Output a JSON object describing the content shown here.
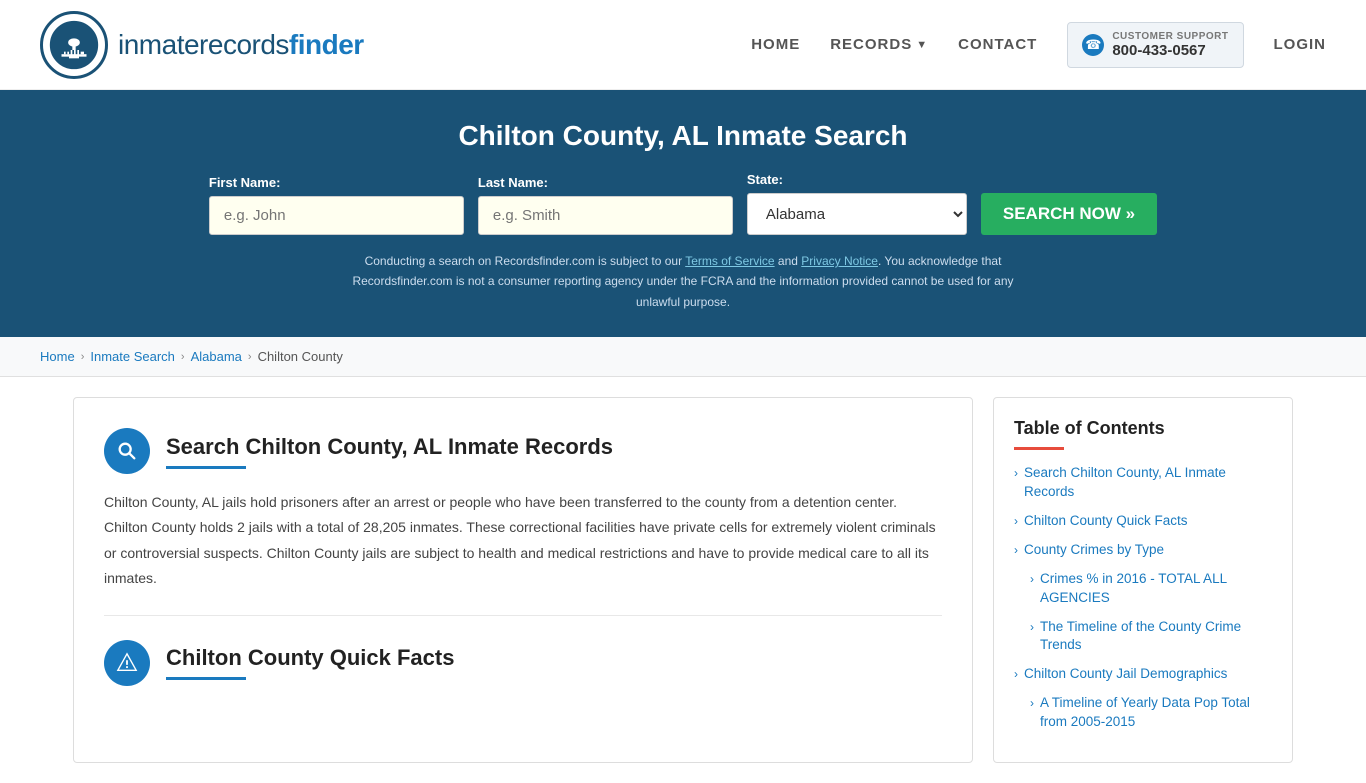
{
  "header": {
    "logo_text_regular": "inmaterecords",
    "logo_text_bold": "finder",
    "nav": {
      "home": "HOME",
      "records": "RECORDS",
      "contact": "CONTACT",
      "login": "LOGIN"
    },
    "support": {
      "label": "CUSTOMER SUPPORT",
      "number": "800-433-0567"
    }
  },
  "hero": {
    "title": "Chilton County, AL Inmate Search",
    "form": {
      "first_name_label": "First Name:",
      "first_name_placeholder": "e.g. John",
      "last_name_label": "Last Name:",
      "last_name_placeholder": "e.g. Smith",
      "state_label": "State:",
      "state_value": "Alabama",
      "search_button": "SEARCH NOW »"
    },
    "disclaimer": "Conducting a search on Recordsfinder.com is subject to our Terms of Service and Privacy Notice. You acknowledge that Recordsfinder.com is not a consumer reporting agency under the FCRA and the information provided cannot be used for any unlawful purpose."
  },
  "breadcrumb": {
    "home": "Home",
    "inmate_search": "Inmate Search",
    "alabama": "Alabama",
    "current": "Chilton County"
  },
  "main": {
    "section1": {
      "title": "Search Chilton County, AL Inmate Records",
      "text": "Chilton County, AL jails hold prisoners after an arrest or people who have been transferred to the county from a detention center. Chilton County holds 2 jails with a total of 28,205 inmates. These correctional facilities have private cells for extremely violent criminals or controversial suspects. Chilton County jails are subject to health and medical restrictions and have to provide medical care to all its inmates."
    },
    "section2": {
      "title": "Chilton County Quick Facts"
    }
  },
  "toc": {
    "title": "Table of Contents",
    "items": [
      {
        "text": "Search Chilton County, AL Inmate Records",
        "level": 1
      },
      {
        "text": "Chilton County Quick Facts",
        "level": 1
      },
      {
        "text": "County Crimes by Type",
        "level": 1
      },
      {
        "text": "Crimes % in 2016 - TOTAL ALL AGENCIES",
        "level": 2
      },
      {
        "text": "The Timeline of the County Crime Trends",
        "level": 2
      },
      {
        "text": "Chilton County Jail Demographics",
        "level": 1
      },
      {
        "text": "A Timeline of Yearly Data Pop Total from 2005-2015",
        "level": 2
      }
    ]
  }
}
